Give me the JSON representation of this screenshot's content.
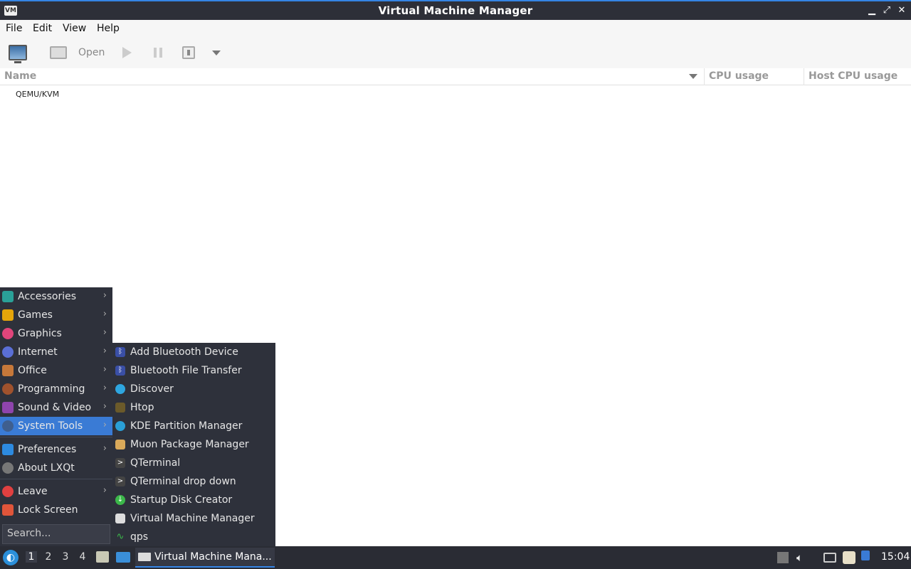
{
  "window": {
    "title": "Virtual Machine Manager"
  },
  "menubar": [
    "File",
    "Edit",
    "View",
    "Help"
  ],
  "toolbar": {
    "open_label": "Open"
  },
  "columns": {
    "name": "Name",
    "cpu": "CPU usage",
    "host_cpu": "Host CPU usage"
  },
  "connections": [
    {
      "name": "QEMU/KVM"
    }
  ],
  "start_menu": {
    "categories": [
      {
        "label": "Accessories",
        "icon": "accessories-icon",
        "color": "#2aa198"
      },
      {
        "label": "Games",
        "icon": "games-icon",
        "color": "#e5a50a"
      },
      {
        "label": "Graphics",
        "icon": "graphics-icon",
        "color": "#e0457b"
      },
      {
        "label": "Internet",
        "icon": "internet-icon",
        "color": "#5a6fd6"
      },
      {
        "label": "Office",
        "icon": "office-icon",
        "color": "#c6783a"
      },
      {
        "label": "Programming",
        "icon": "programming-icon",
        "color": "#a0522d"
      },
      {
        "label": "Sound & Video",
        "icon": "sound-video-icon",
        "color": "#8e44ad"
      },
      {
        "label": "System Tools",
        "icon": "system-tools-icon",
        "color": "#3f5f8f"
      }
    ],
    "prefs": [
      {
        "label": "Preferences",
        "icon": "preferences-icon",
        "color": "#2d8ae0"
      },
      {
        "label": "About LXQt",
        "icon": "info-icon",
        "color": "#777"
      }
    ],
    "power": [
      {
        "label": "Leave",
        "icon": "power-icon",
        "color": "#e04040"
      },
      {
        "label": "Lock Screen",
        "icon": "lock-icon",
        "color": "#e0553a"
      }
    ],
    "search_placeholder": "Search..."
  },
  "system_tools": [
    {
      "label": "Add Bluetooth Device",
      "icon": "bluetooth-icon",
      "color": "#3a4fa6"
    },
    {
      "label": "Bluetooth File Transfer",
      "icon": "bluetooth-icon",
      "color": "#3a4fa6"
    },
    {
      "label": "Discover",
      "icon": "discover-icon",
      "color": "#2ea6e0"
    },
    {
      "label": "Htop",
      "icon": "htop-icon",
      "color": "#6b5a2a"
    },
    {
      "label": "KDE Partition Manager",
      "icon": "partition-icon",
      "color": "#2a9fd6"
    },
    {
      "label": "Muon Package Manager",
      "icon": "package-icon",
      "color": "#d9a95a"
    },
    {
      "label": "QTerminal",
      "icon": "terminal-icon",
      "color": "#444"
    },
    {
      "label": "QTerminal drop down",
      "icon": "terminal-icon",
      "color": "#444"
    },
    {
      "label": "Startup Disk Creator",
      "icon": "startup-disk-icon",
      "color": "#3cb84a"
    },
    {
      "label": "Virtual Machine Manager",
      "icon": "virt-manager-icon",
      "color": "#ddd"
    },
    {
      "label": "qps",
      "icon": "qps-icon",
      "color": "#3cb84a"
    }
  ],
  "taskbar": {
    "workspaces": [
      "1",
      "2",
      "3",
      "4"
    ],
    "task_label": "Virtual Machine Mana...",
    "clock": "15:04"
  }
}
